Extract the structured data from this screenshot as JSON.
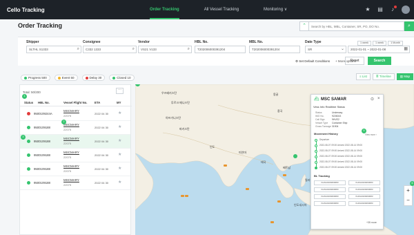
{
  "app": {
    "title": "Cello Tracking"
  },
  "nav": [
    {
      "label": "Order Tracking",
      "active": true
    },
    {
      "label": "All Vessel Tracking",
      "active": false
    },
    {
      "label": "Monitoring ∨",
      "active": false
    }
  ],
  "page_title": "Order Tracking",
  "search": {
    "placeholder": "Search by HBL, MBL, Container, SR, PO, DO No."
  },
  "filters": {
    "shipper": {
      "label": "Shipper",
      "value": "SLTHL S1333"
    },
    "consignee": {
      "label": "Consignee",
      "value": "C332 1333"
    },
    "vendor": {
      "label": "Vendor",
      "value": "VS21 V133"
    },
    "hbl": {
      "label": "HBL No.",
      "value": "T202006000391204"
    },
    "mbl": {
      "label": "MBL No.",
      "value": "T202006000391204"
    },
    "date_type": {
      "label": "Date Type",
      "value": "SR"
    },
    "date_range": "2022-01-01 ~ 2022-01-08",
    "quick": [
      "1 week",
      "1 week",
      "1 Month"
    ],
    "reset_label": "Reset",
    "search_label": "Search",
    "default_conditions": "Set Default Conditions",
    "more_options": "+ More options"
  },
  "legend": [
    {
      "label": "Progress 500",
      "color": "#35c46e"
    },
    {
      "label": "Event 50",
      "color": "#f0b429"
    },
    {
      "label": "Delay 30",
      "color": "#e23b3b"
    },
    {
      "label": "Closed 10",
      "color": "#35c46e"
    }
  ],
  "views": [
    {
      "label": "List",
      "active": false
    },
    {
      "label": "Timeline",
      "active": false
    },
    {
      "label": "Map",
      "active": true
    }
  ],
  "list": {
    "total": "Total: 50/200",
    "columns": [
      "Status",
      "HBL No.",
      "Vessel Flight No.",
      "ETA",
      "MY"
    ],
    "rows": [
      {
        "status_color": "#e23b3b",
        "hbl": "9500109244A",
        "vessel": "MSCMARY",
        "voyage": "22075",
        "eta": "2022 04 30",
        "selected": false
      },
      {
        "status_color": "#35c46e",
        "hbl": "9500109188",
        "vessel": "MSCMARY",
        "voyage": "22075",
        "eta": "2022 04 30",
        "selected": false
      },
      {
        "status_color": "#35c46e",
        "hbl": "9500109188",
        "vessel": "MSCMARY",
        "voyage": "22075",
        "eta": "2022 04 30",
        "selected": true
      },
      {
        "status_color": "#35c46e",
        "hbl": "9500109188",
        "vessel": "MSCMARY",
        "voyage": "22075",
        "eta": "2022 04 30",
        "selected": false
      },
      {
        "status_color": "#35c46e",
        "hbl": "9500109188",
        "vessel": "MSCMARY",
        "voyage": "22075",
        "eta": "2022 04 30",
        "selected": false
      },
      {
        "status_color": "#35c46e",
        "hbl": "9500109188",
        "vessel": "MSCMARY",
        "voyage": "22075",
        "eta": "2022 04 30",
        "selected": false
      }
    ]
  },
  "map": {
    "cities": [
      "우즈베키스탄",
      "투르크 메니스탄",
      "아프가니스탄",
      "파키스탄",
      "중국",
      "인도",
      "미얀마",
      "태국",
      "베트남",
      "필리핀",
      "인도네시아",
      "몽골"
    ]
  },
  "popup": {
    "title": "MSC SAMAR",
    "tabs": "Vess Info   Realtime Status",
    "info": [
      {
        "k": "Status",
        "v": "Underway"
      },
      {
        "k": "IMO No.",
        "v": "9226043"
      },
      {
        "k": "Call Sign",
        "v": "9HVE2"
      },
      {
        "k": "Vessel Type",
        "v": "Container Ship"
      },
      {
        "k": "Gross Tonnage",
        "v": "31904"
      }
    ],
    "movement_title": "Movement History",
    "movement_more": "View more ›",
    "movements": [
      "Departure",
      "2022-08-07 09:00   Arrived 2022-08-14 09:00",
      "2022-08-07 09:00   Arrived 2022-08-14 09:00",
      "2022-08-07 09:00   Arrived 2022-08-14 09:00",
      "2022-08-07 09:00   Arrived 2022-08-14 09:00",
      "2022-08-07 09:00   Arrived 2022-08-14 09:00"
    ],
    "bl_title": "BL Tracking",
    "bl_cells": [
      "KHNA0109260083",
      "KHNA0109260083",
      "KHNA0109260083",
      "KHNA0109260083",
      "KHNA0109260083",
      "KHNA0109260083",
      "KHNA0109260083",
      "KHNA0109260083"
    ],
    "bl_more": "+35 more"
  }
}
